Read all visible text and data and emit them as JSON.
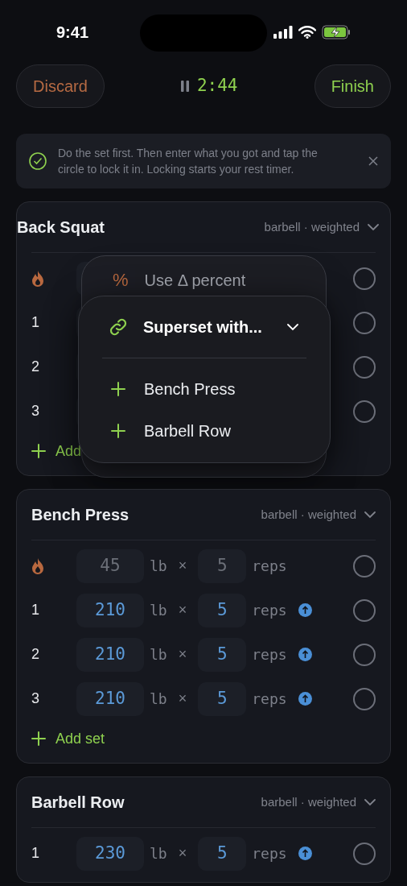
{
  "status_bar": {
    "time": "9:41"
  },
  "header": {
    "discard": "Discard",
    "timer": "2:44",
    "finish": "Finish"
  },
  "tip": {
    "text": "Do the set first. Then enter what you got and tap the circle to lock it in. Locking starts your rest timer."
  },
  "exercises": [
    {
      "name": "Back Squat",
      "meta": "barbell · weighted",
      "sets": [
        {
          "kind": "warmup",
          "checked": false
        },
        {
          "kind": "working",
          "label": "1",
          "checked": false
        },
        {
          "kind": "working",
          "label": "2",
          "checked": false
        },
        {
          "kind": "working",
          "label": "3",
          "checked": false
        }
      ],
      "add_label": "Add",
      "menus": [
        {
          "kind": "option",
          "icon": "%",
          "label": "Use Δ percent"
        },
        {
          "kind": "superset",
          "title": "Superset with...",
          "items": [
            "Bench Press",
            "Barbell Row"
          ]
        }
      ]
    },
    {
      "name": "Bench Press",
      "meta": "barbell · weighted",
      "sets": [
        {
          "kind": "warmup",
          "weight": "45",
          "unit": "lb",
          "times": "×",
          "reps": "5",
          "reps_unit": "reps",
          "increase": false,
          "checked": false
        },
        {
          "kind": "working",
          "label": "1",
          "weight": "210",
          "unit": "lb",
          "times": "×",
          "reps": "5",
          "reps_unit": "reps",
          "increase": true,
          "checked": false
        },
        {
          "kind": "working",
          "label": "2",
          "weight": "210",
          "unit": "lb",
          "times": "×",
          "reps": "5",
          "reps_unit": "reps",
          "increase": true,
          "checked": false
        },
        {
          "kind": "working",
          "label": "3",
          "weight": "210",
          "unit": "lb",
          "times": "×",
          "reps": "5",
          "reps_unit": "reps",
          "increase": true,
          "checked": false
        }
      ],
      "add_label": "Add set"
    },
    {
      "name": "Barbell Row",
      "meta": "barbell · weighted",
      "sets": [
        {
          "kind": "working",
          "label": "1",
          "weight": "230",
          "unit": "lb",
          "times": "×",
          "reps": "5",
          "reps_unit": "reps",
          "increase": true,
          "checked": false
        }
      ]
    }
  ]
}
